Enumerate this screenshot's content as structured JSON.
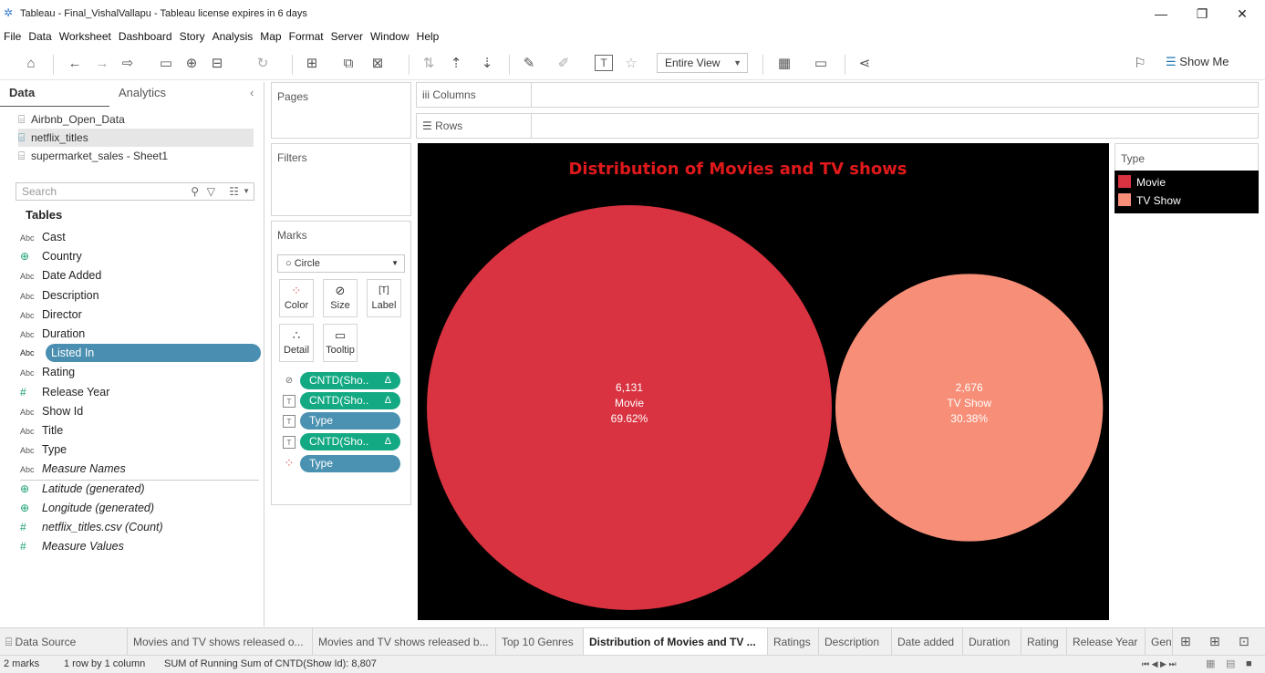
{
  "window": {
    "title": "Tableau - Final_VishalVallapu - Tableau license expires in 6 days",
    "minimize": "—",
    "restore": "❐",
    "close": "✕"
  },
  "menu": [
    "File",
    "Data",
    "Worksheet",
    "Dashboard",
    "Story",
    "Analysis",
    "Map",
    "Format",
    "Server",
    "Window",
    "Help"
  ],
  "toolbar": {
    "fit_value": "Entire View",
    "show_me_label": "Show Me"
  },
  "data_pane": {
    "tab_data": "Data",
    "tab_analytics": "Analytics",
    "data_sources": [
      "Airbnb_Open_Data",
      "netflix_titles",
      "supermarket_sales - Sheet1"
    ],
    "search_placeholder": "Search",
    "tables_heading": "Tables",
    "fields": [
      {
        "type": "Abc",
        "name": "Cast"
      },
      {
        "type": "globe",
        "name": "Country"
      },
      {
        "type": "Abc",
        "name": "Date Added"
      },
      {
        "type": "Abc",
        "name": "Description"
      },
      {
        "type": "Abc",
        "name": "Director"
      },
      {
        "type": "Abc",
        "name": "Duration"
      },
      {
        "type": "Abc",
        "name": "Listed In"
      },
      {
        "type": "Abc",
        "name": "Rating"
      },
      {
        "type": "#",
        "name": "Release Year"
      },
      {
        "type": "Abc",
        "name": "Show Id"
      },
      {
        "type": "Abc",
        "name": "Title"
      },
      {
        "type": "Abc",
        "name": "Type"
      },
      {
        "type": "Abc",
        "name": "Measure Names"
      }
    ],
    "measures": [
      {
        "type": "globe",
        "name": "Latitude (generated)"
      },
      {
        "type": "globe",
        "name": "Longitude (generated)"
      },
      {
        "type": "#",
        "name": "netflix_titles.csv (Count)"
      },
      {
        "type": "#",
        "name": "Measure Values"
      }
    ]
  },
  "cards": {
    "pages": "Pages",
    "filters": "Filters",
    "marks": "Marks",
    "mark_type": "Circle",
    "mark_buttons": [
      "Color",
      "Size",
      "Label",
      "Detail",
      "Tooltip"
    ],
    "pills": [
      {
        "text": "CNTD(Sho..",
        "delta": "Δ",
        "kind": "size"
      },
      {
        "text": "CNTD(Sho..",
        "delta": "Δ",
        "kind": "label"
      },
      {
        "text": "Type",
        "kind": "label"
      },
      {
        "text": "CNTD(Sho..",
        "delta": "Δ",
        "kind": "label"
      },
      {
        "text": "Type",
        "kind": "color"
      }
    ]
  },
  "shelves": {
    "columns": "Columns",
    "rows": "Rows"
  },
  "chart_data": {
    "type": "bubble",
    "title": "Distribution of Movies and TV shows",
    "categories": [
      "Movie",
      "TV Show"
    ],
    "values": [
      6131,
      2676
    ],
    "value_labels": [
      "6,131",
      "2,676"
    ],
    "percent_labels": [
      "69.62%",
      "30.38%"
    ],
    "colors": [
      "#d93240",
      "#f78e77"
    ],
    "background": "#000000",
    "legend": {
      "title": "Type",
      "items": [
        "Movie",
        "TV Show"
      ],
      "placement": "right"
    }
  },
  "sheet_tabs": [
    {
      "label": "Data Source"
    },
    {
      "label": "Movies and TV shows released o..."
    },
    {
      "label": "Movies and TV shows released b..."
    },
    {
      "label": "Top 10 Genres"
    },
    {
      "label": "Distribution of Movies and TV ...",
      "active": true
    },
    {
      "label": "Ratings"
    },
    {
      "label": "Description"
    },
    {
      "label": "Date added"
    },
    {
      "label": "Duration"
    },
    {
      "label": "Rating"
    },
    {
      "label": "Release Year"
    },
    {
      "label": "Gen"
    }
  ],
  "status": {
    "marks": "2 marks",
    "dims": "1 row by 1 column",
    "sum": "SUM of Running Sum of CNTD(Show Id): 8,807"
  }
}
